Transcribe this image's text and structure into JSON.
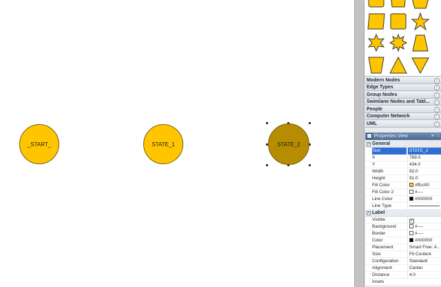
{
  "canvas": {
    "nodes": [
      {
        "label": "_START_",
        "color": "#ffc600"
      },
      {
        "label": "STATE_1",
        "color": "#ffc600"
      },
      {
        "label": "STATE_2",
        "color": "#b68d00",
        "selected": true
      }
    ]
  },
  "palette": {
    "shape_icons": [
      "star-icon",
      "hexagon-icon",
      "trapezoid-icon",
      "triangle-icon",
      "inverted-triangle-icon"
    ],
    "sections": [
      {
        "label": "Modern Nodes"
      },
      {
        "label": "Edge Types"
      },
      {
        "label": "Group Nodes"
      },
      {
        "label": "Swimlane Nodes and Tabl..."
      },
      {
        "label": "People"
      },
      {
        "label": "Computer Network"
      },
      {
        "label": "UML"
      }
    ]
  },
  "properties": {
    "title": "Properties View",
    "general_label": "General",
    "general": [
      {
        "key": "Text",
        "value": "STATE_2"
      },
      {
        "key": "X",
        "value": "769.0"
      },
      {
        "key": "Y",
        "value": "434.0"
      },
      {
        "key": "Width",
        "value": "92.0"
      },
      {
        "key": "Height",
        "value": "91.0"
      },
      {
        "key": "Fill Color",
        "value": "#ffcc00"
      },
      {
        "key": "Fill Color 2",
        "value": "#----"
      },
      {
        "key": "Line Color",
        "value": "#000000"
      },
      {
        "key": "Line Type",
        "value": ""
      }
    ],
    "label_label": "Label",
    "label": [
      {
        "key": "Visible",
        "value": ""
      },
      {
        "key": "Background",
        "value": "#----"
      },
      {
        "key": "Border",
        "value": "#----"
      },
      {
        "key": "Color",
        "value": "#000000"
      },
      {
        "key": "Placement",
        "value": "Smart Free: A..."
      },
      {
        "key": "Size",
        "value": "Fit Content"
      },
      {
        "key": "Configuration",
        "value": "Standard"
      },
      {
        "key": "Alignment",
        "value": "Center"
      },
      {
        "key": "Distance",
        "value": "4.0"
      },
      {
        "key": "Insets",
        "value": ""
      }
    ]
  }
}
